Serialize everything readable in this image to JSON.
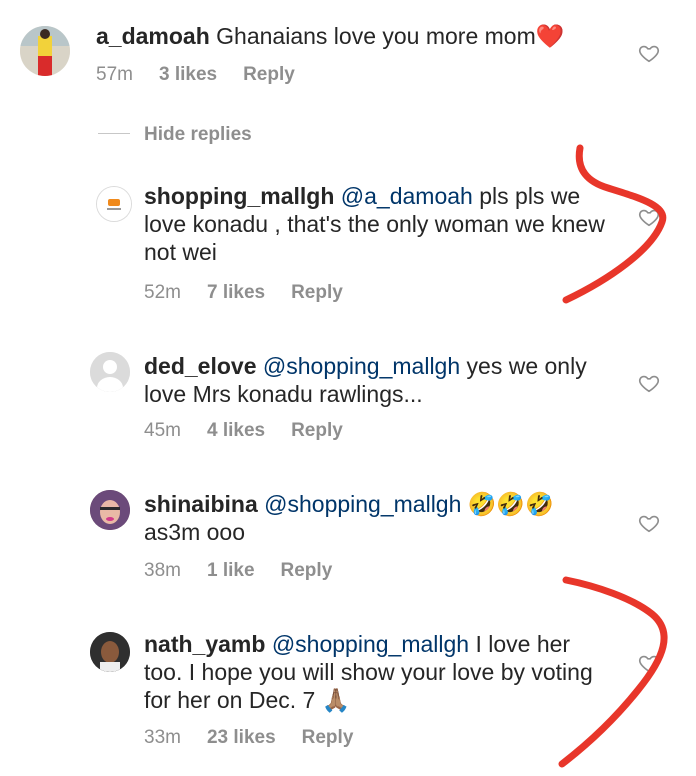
{
  "comments": [
    {
      "username": "a_damoah",
      "mention": "",
      "text": "Ghanaians love you more mom",
      "emoji": "❤️",
      "time": "57m",
      "likes": "3 likes",
      "reply": "Reply"
    },
    {
      "username": "shopping_mallgh",
      "mention": "@a_damoah",
      "text": "pls pls we love konadu , that's the only woman we knew not wei",
      "emoji": "",
      "time": "52m",
      "likes": "7 likes",
      "reply": "Reply"
    },
    {
      "username": "ded_elove",
      "mention": "@shopping_mallgh",
      "text": "yes we only love Mrs konadu rawlings...",
      "emoji": "",
      "time": "45m",
      "likes": "4 likes",
      "reply": "Reply"
    },
    {
      "username": "shinaibina",
      "mention": "@shopping_mallgh",
      "text": "as3m ooo",
      "emoji": "🤣🤣🤣",
      "time": "38m",
      "likes": "1 like",
      "reply": "Reply"
    },
    {
      "username": "nath_yamb",
      "mention": "@shopping_mallgh",
      "text": "I love her too. I hope you will show your love by voting for her on Dec. 7",
      "emoji": "🙏🏽",
      "time": "33m",
      "likes": "23 likes",
      "reply": "Reply"
    }
  ],
  "hide_replies": "Hide replies",
  "icons": {
    "heart": "heart-outline-icon",
    "annotation": "red-arrow-mark"
  },
  "colors": {
    "text": "#262626",
    "mention": "#003569",
    "meta": "#8e8e8e",
    "annotation": "#e8362a"
  }
}
